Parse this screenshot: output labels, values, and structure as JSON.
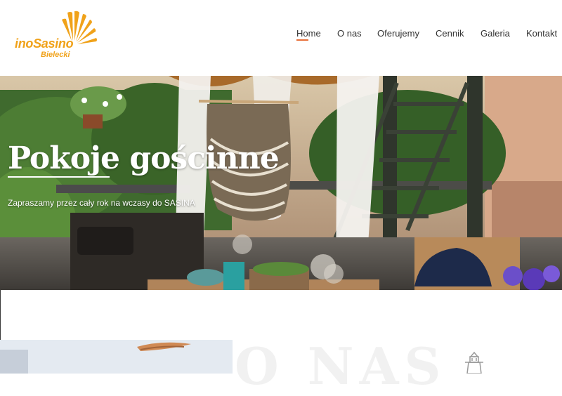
{
  "logo": {
    "main": "inoSasino",
    "sub": "Bielecki",
    "color": "#f0a21a"
  },
  "nav": {
    "active_color": "#e8703a",
    "items": [
      {
        "label": "Home",
        "active": true
      },
      {
        "label": "O nas",
        "active": false
      },
      {
        "label": "Oferujemy",
        "active": false
      },
      {
        "label": "Cennik",
        "active": false
      },
      {
        "label": "Galeria",
        "active": false
      },
      {
        "label": "Kontakt",
        "active": false
      }
    ]
  },
  "hero": {
    "title": "Pokoje gościnne",
    "subtitle": "Zapraszamy przez cały rok na wczasy do SASINA"
  },
  "about": {
    "watermark": "O NAS"
  }
}
